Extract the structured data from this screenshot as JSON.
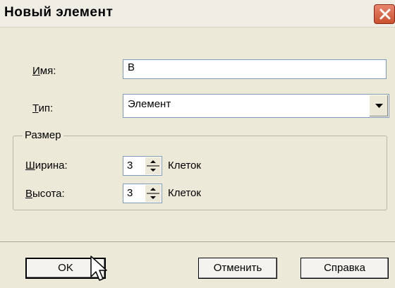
{
  "window": {
    "title": "Новый элемент",
    "close_icon": "close-icon"
  },
  "fields": {
    "name": {
      "label_mnemonic": "И",
      "label_rest": "мя:",
      "value": "В"
    },
    "type": {
      "label_mnemonic": "Т",
      "label_rest": "ип:",
      "value": "Элемент"
    }
  },
  "size_group": {
    "legend": "Размер",
    "width": {
      "label_mnemonic": "Ш",
      "label_rest": "ирина:",
      "value": "3",
      "unit": "Клеток"
    },
    "height": {
      "label_mnemonic": "В",
      "label_rest": "ысота:",
      "value": "3",
      "unit": "Клеток"
    }
  },
  "buttons": {
    "ok": "OK",
    "cancel": "Отменить",
    "help": "Справка"
  }
}
